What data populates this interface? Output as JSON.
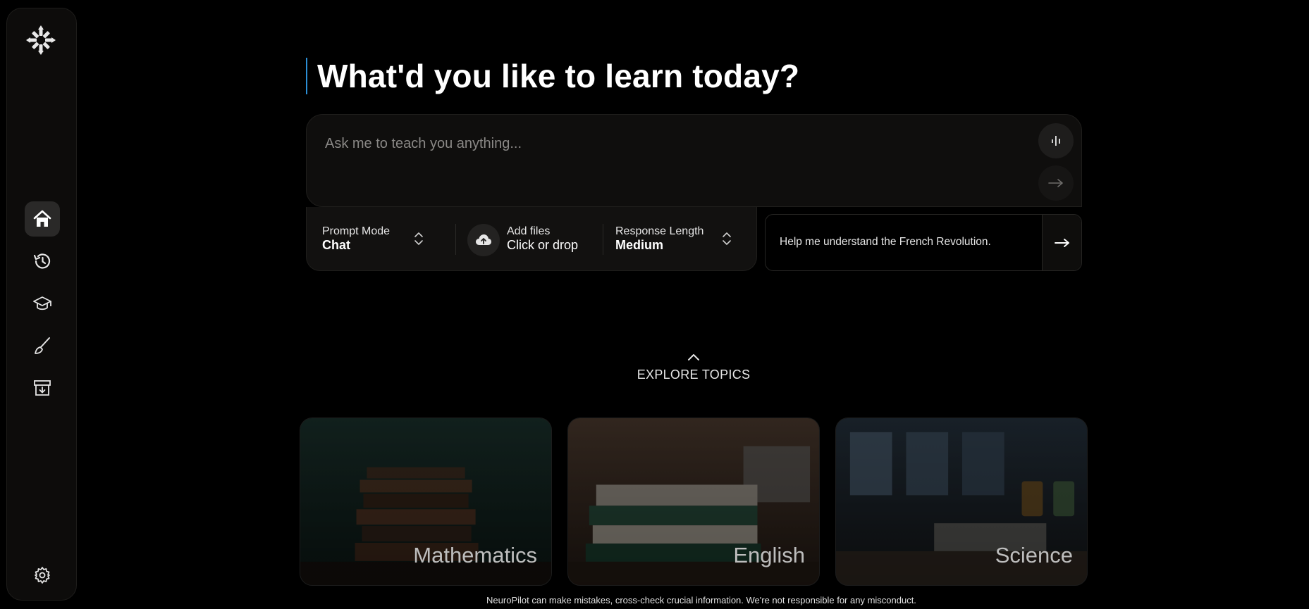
{
  "sidebar": {
    "logo_icon": "asterisk-snowflake-logo",
    "items": [
      {
        "name": "home",
        "icon": "home-icon",
        "active": true
      },
      {
        "name": "history",
        "icon": "history-icon",
        "active": false
      },
      {
        "name": "learn",
        "icon": "graduation-cap-icon",
        "active": false
      },
      {
        "name": "create",
        "icon": "brush-icon",
        "active": false
      },
      {
        "name": "archive",
        "icon": "archive-icon",
        "active": false
      }
    ],
    "settings_icon": "gear-icon"
  },
  "main": {
    "heading": "What'd you like to learn today?",
    "prompt": {
      "placeholder": "Ask me to teach you anything...",
      "value": ""
    },
    "options": {
      "prompt_mode": {
        "label": "Prompt Mode",
        "value": "Chat"
      },
      "files": {
        "label": "Add files",
        "value": "Click or drop"
      },
      "response_length": {
        "label": "Response Length",
        "value": "Medium"
      }
    },
    "suggestion": "Help me understand the French Revolution.",
    "explore_label": "EXPLORE TOPICS",
    "topics": [
      {
        "label": "Mathematics"
      },
      {
        "label": "English"
      },
      {
        "label": "Science"
      }
    ],
    "disclaimer": "NeuroPilot can make mistakes, cross-check crucial information. We're not responsible for any misconduct."
  },
  "colors": {
    "accent": "#2b8fd6",
    "background": "#000000",
    "panel": "#0f0e0d"
  }
}
